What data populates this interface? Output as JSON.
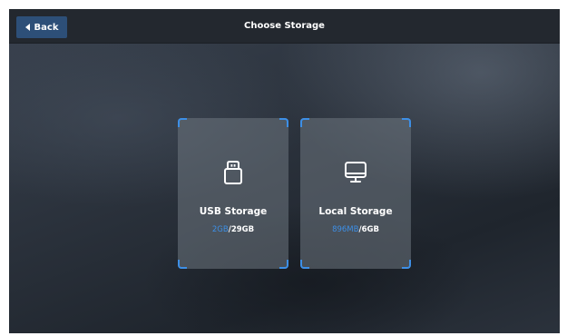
{
  "header": {
    "back_label": "Back",
    "title": "Choose Storage"
  },
  "storage_options": [
    {
      "label": "USB Storage",
      "used": "2GB",
      "separator": "/",
      "total": "29GB",
      "icon": "usb-drive-icon"
    },
    {
      "label": "Local Storage",
      "used": "896MB",
      "separator": "/",
      "total": "6GB",
      "icon": "monitor-icon"
    }
  ],
  "colors": {
    "accent": "#3d8fe6",
    "back_button": "#2d4f78",
    "topbar": "#23282f"
  }
}
